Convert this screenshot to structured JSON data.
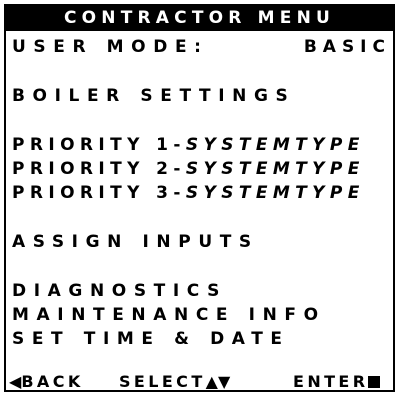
{
  "header": {
    "title": "CONTRACTOR MENU"
  },
  "user_mode": {
    "label": "USER MODE:",
    "value": "BASIC"
  },
  "menu": {
    "boiler_settings": "BOILER SETTINGS",
    "priorities": [
      {
        "label": "PRIORITY 1-",
        "type": "SYSTEMTYPE"
      },
      {
        "label": "PRIORITY 2-",
        "type": "SYSTEMTYPE"
      },
      {
        "label": "PRIORITY 3-",
        "type": "SYSTEMTYPE"
      }
    ],
    "assign_inputs": "ASSIGN INPUTS",
    "diagnostics": "DIAGNOSTICS",
    "maintenance_info": "MAINTENANCE INFO",
    "set_time_date": "SET TIME & DATE"
  },
  "footer": {
    "back_label": "BACK",
    "select_label": "SELECT",
    "enter_label": "ENTER",
    "back_icon": "left-triangle-icon",
    "select_icons": [
      "up-triangle-icon",
      "down-triangle-icon"
    ],
    "enter_icon": "filled-square-icon"
  },
  "colors": {
    "foreground": "#000000",
    "background": "#ffffff"
  }
}
